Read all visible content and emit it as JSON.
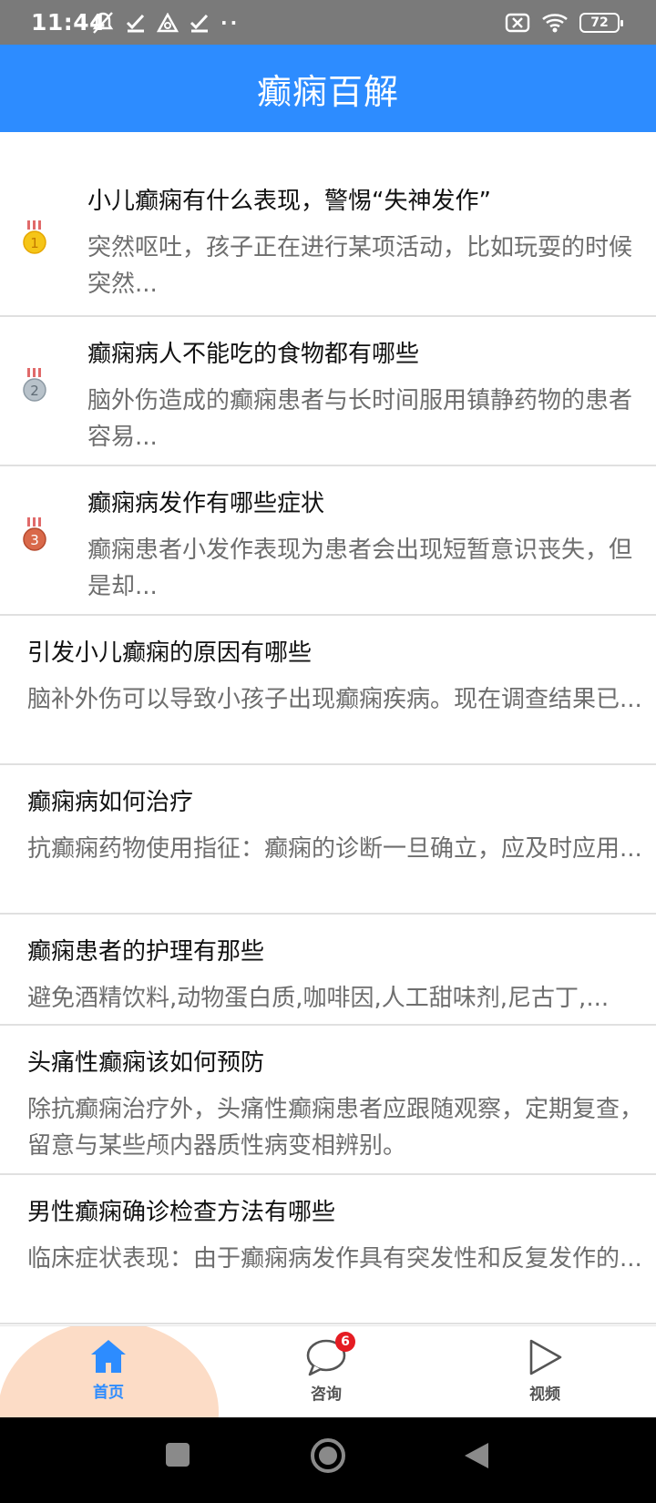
{
  "status_bar": {
    "time": "11:44",
    "dots": "··",
    "battery": "72"
  },
  "app_bar": {
    "title": "癫痫百解"
  },
  "articles": [
    {
      "rank": "1",
      "rank_color": "#f5c518",
      "title": "小儿癫痫有什么表现，警惕“失神发作”",
      "summary": "突然呕吐，孩子正在进行某项活动，比如玩耍的时候突然..."
    },
    {
      "rank": "2",
      "rank_color": "#a9b4bd",
      "title": "癫痫病人不能吃的食物都有哪些",
      "summary": "脑外伤造成的癫痫患者与长时间服用镇静药物的患者容易..."
    },
    {
      "rank": "3",
      "rank_color": "#d9694a",
      "title": "癫痫病发作有哪些症状",
      "summary": "癫痫患者小发作表现为患者会出现短暂意识丧失，但是却..."
    },
    {
      "title": "引发小儿癫痫的原因有哪些",
      "summary": "脑补外伤可以导致小孩子出现癫痫疾病。现在调查结果已..."
    },
    {
      "title": "癫痫病如何治疗",
      "summary": "抗癫痫药物使用指征：癫痫的诊断一旦确立，应及时应用..."
    },
    {
      "title": "癫痫患者的护理有那些",
      "summary": "避免酒精饮料,动物蛋白质,咖啡因,人工甜味剂,尼古丁,..."
    },
    {
      "title": "头痛性癫痫该如何预防",
      "summary": "除抗癫痫治疗外，头痛性癫痫患者应跟随观察，定期复查，留意与某些颅内器质性病变相辨别。"
    },
    {
      "title": "男性癫痫确诊检查方法有哪些",
      "summary": "临床症状表现：由于癫痫病发作具有突发性和反复发作的..."
    }
  ],
  "bottom_nav": {
    "home_label": "首页",
    "consult_label": "咨询",
    "consult_badge": "6",
    "video_label": "视频",
    "active_color": "#2d8cff"
  }
}
